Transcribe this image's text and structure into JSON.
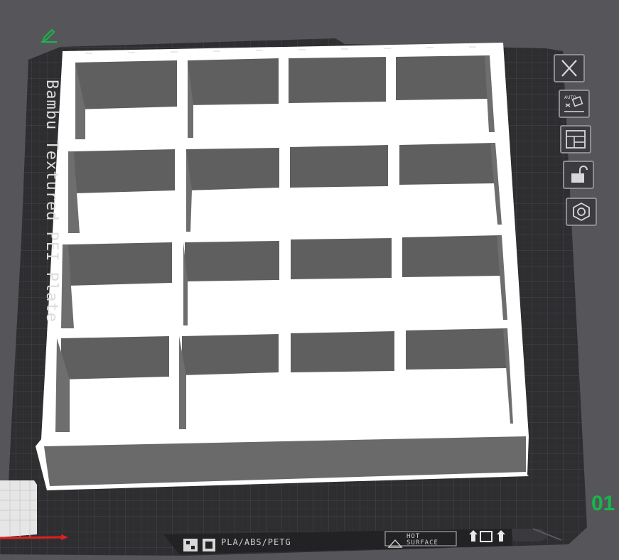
{
  "plate": {
    "label": "Bambu Textured PEI Plate",
    "material_text": "PLA/ABS/PETG",
    "hot_surface_line1": "HOT",
    "hot_surface_line2": "SURFACE"
  },
  "overlay": {
    "layer_number": "01"
  },
  "toolbar": {
    "buttons": [
      {
        "name": "close-plate-button",
        "icon": "close-icon"
      },
      {
        "name": "auto-orient-button",
        "icon": "auto-orient-icon"
      },
      {
        "name": "arrange-button",
        "icon": "arrange-icon"
      },
      {
        "name": "lock-plate-button",
        "icon": "unlock-icon"
      },
      {
        "name": "plate-settings-button",
        "icon": "hex-nut-icon"
      }
    ],
    "edit_icon": "pencil-icon"
  },
  "colors": {
    "background": "#56565a",
    "plate": "#2f2f32",
    "grid_line": "#454549",
    "model_white": "#ffffff",
    "model_shadow": "#6e6e6e",
    "accent_green": "#17b74a",
    "axis_red": "#e0201c"
  }
}
